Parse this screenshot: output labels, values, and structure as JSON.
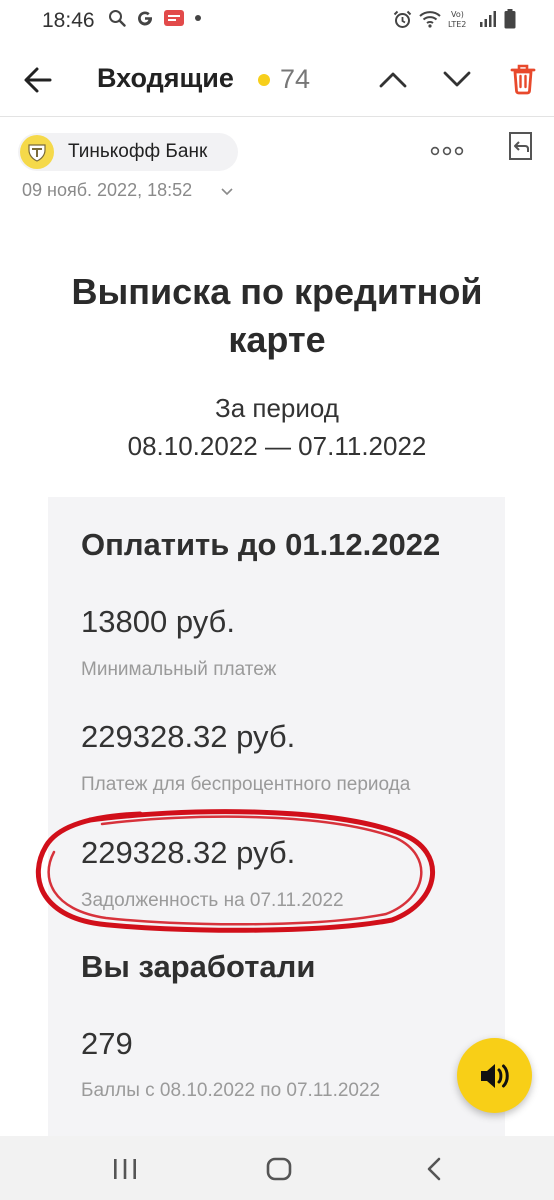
{
  "status_bar": {
    "time": "18:46",
    "left_icons": [
      "search-icon",
      "google-icon",
      "notification-badge-icon",
      "dot-icon"
    ],
    "right_icons": [
      "alarm-icon",
      "wifi-icon",
      "volte-icon",
      "signal-icon",
      "battery-icon"
    ]
  },
  "header": {
    "folder_title": "Входящие",
    "unread_count": "74",
    "unread_dot_color": "#f7cf1b",
    "icons": [
      "back-arrow-icon",
      "chevron-up-icon",
      "chevron-down-icon",
      "trash-icon"
    ],
    "trash_color": "#e8492c"
  },
  "message": {
    "sender": "Тинькофф Банк",
    "date": "09 нояб. 2022, 18:52",
    "icons": [
      "more-dots-icon",
      "reply-icon",
      "chevron-down-icon"
    ]
  },
  "statement": {
    "title_line1": "Выписка по кредитной",
    "title_line2": "карте",
    "period_label": "За период",
    "period_value": "08.10.2022 — 07.11.2022"
  },
  "card": {
    "pay_heading": "Оплатить до 01.12.2022",
    "min_payment_amount": "13800 руб.",
    "min_payment_caption": "Минимальный платеж",
    "grace_amount": "229328.32 руб.",
    "grace_caption": "Платеж для беспроцентного периода",
    "debt_amount": "229328.32 руб.",
    "debt_caption": "Задолженность на 07.11.2022",
    "earned_heading": "Вы заработали",
    "points_amount": "279",
    "points_caption": "Баллы с 08.10.2022 по 07.11.2022",
    "highlight_color": "#d10f1a"
  },
  "fab": {
    "icon": "speaker-icon",
    "color": "#f8cf17"
  },
  "system_nav": {
    "icons": [
      "recent-apps-icon",
      "home-icon",
      "back-icon"
    ]
  }
}
